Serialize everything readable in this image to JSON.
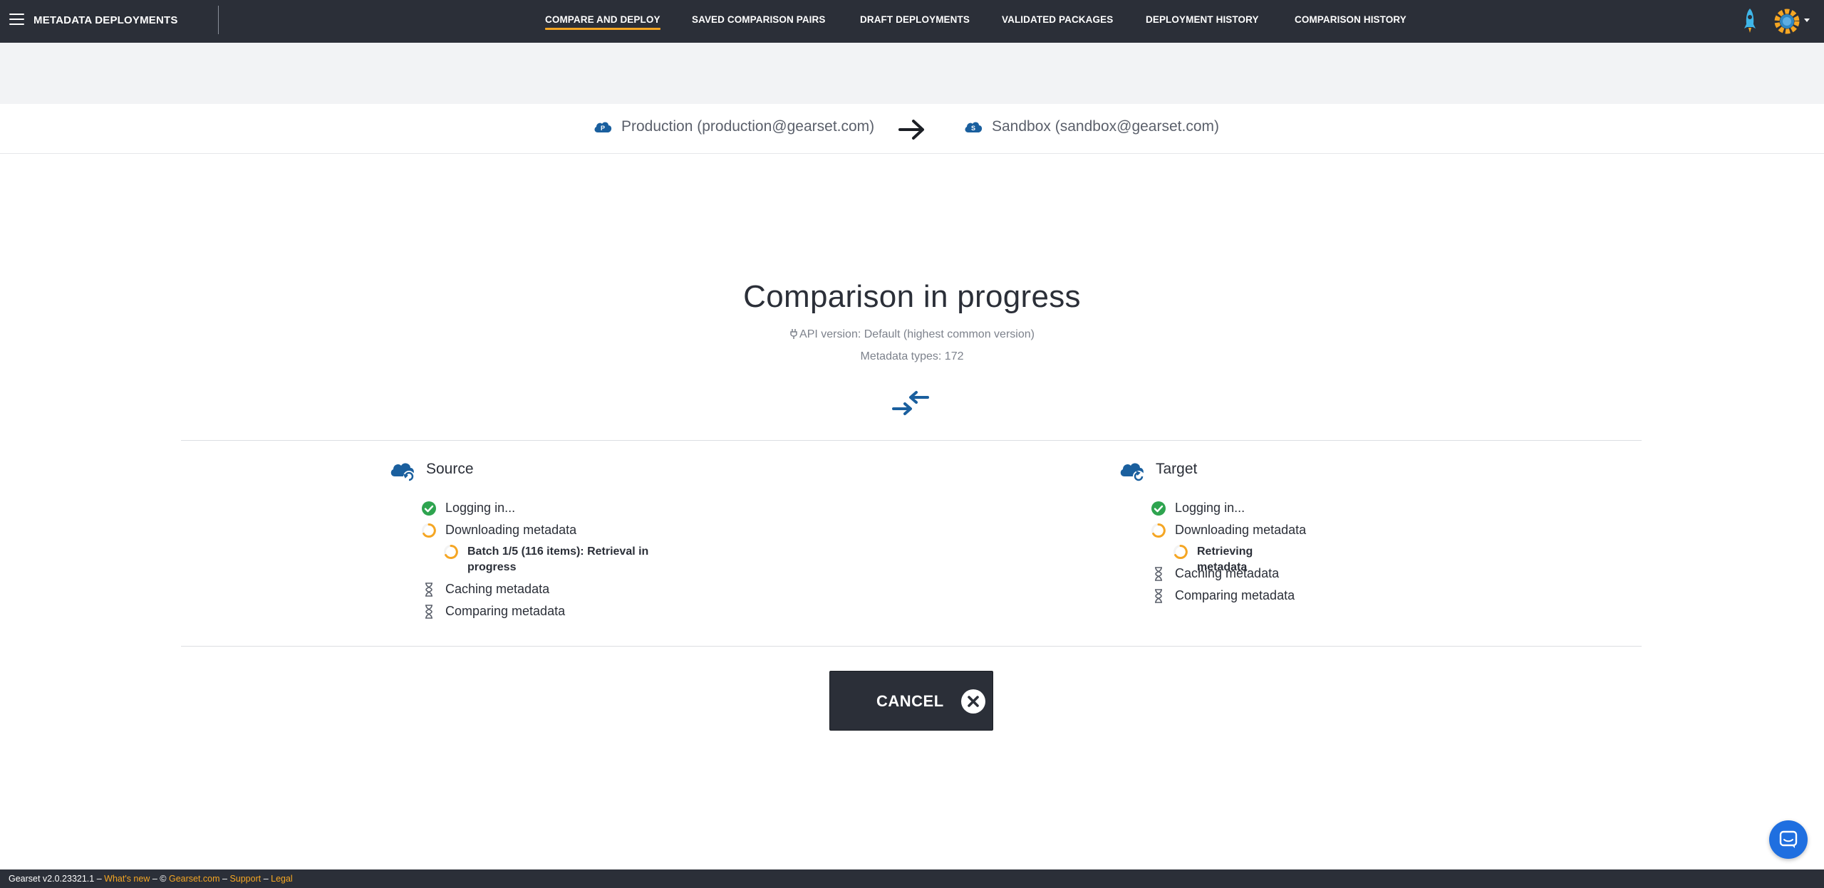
{
  "header": {
    "app_title": "METADATA DEPLOYMENTS",
    "tabs": [
      {
        "label": "COMPARE AND DEPLOY",
        "active": true
      },
      {
        "label": "SAVED COMPARISON PAIRS",
        "active": false
      },
      {
        "label": "DRAFT DEPLOYMENTS",
        "active": false
      },
      {
        "label": "VALIDATED PACKAGES",
        "active": false
      },
      {
        "label": "DEPLOYMENT HISTORY",
        "active": false
      },
      {
        "label": "COMPARISON HISTORY",
        "active": false
      }
    ],
    "icons": [
      "menu-icon",
      "rocket-icon",
      "gear-icon",
      "chevron-down-icon"
    ]
  },
  "orgs": {
    "source": {
      "badge": "P",
      "label": "Production (production@gearset.com)"
    },
    "target": {
      "badge": "S",
      "label": "Sandbox (sandbox@gearset.com)"
    }
  },
  "status": {
    "title": "Comparison in progress",
    "api_version": "API version: Default (highest common version)",
    "metadata_types": "Metadata types: 172"
  },
  "source_panel": {
    "label": "Source",
    "steps": [
      {
        "label": "Logging in...",
        "state": "done"
      },
      {
        "label": "Downloading metadata",
        "state": "in-progress"
      },
      {
        "label": "Batch 1/5 (116 items): Retrieval in progress",
        "state": "in-progress",
        "sub": true
      },
      {
        "label": "Caching metadata",
        "state": "pending"
      },
      {
        "label": "Comparing metadata",
        "state": "pending"
      }
    ]
  },
  "target_panel": {
    "label": "Target",
    "steps": [
      {
        "label": "Logging in...",
        "state": "done"
      },
      {
        "label": "Downloading metadata",
        "state": "in-progress"
      },
      {
        "label": "Retrieving metadata",
        "state": "in-progress",
        "sub": true
      },
      {
        "label": "Caching metadata",
        "state": "pending"
      },
      {
        "label": "Comparing metadata",
        "state": "pending"
      }
    ]
  },
  "cancel": {
    "label": "CANCEL"
  },
  "footer": {
    "version": "Gearset v2.0.23321.1",
    "sep": " – ",
    "whats_new": "What's new",
    "copyright": "©",
    "site": "Gearset.com",
    "support": "Support",
    "legal": "Legal"
  },
  "colors": {
    "navbar": "#2b2f38",
    "accent": "#f5a623",
    "brand_blue": "#1a5f9e",
    "success": "#2ea44f",
    "chat_blue": "#1f6fe0"
  }
}
